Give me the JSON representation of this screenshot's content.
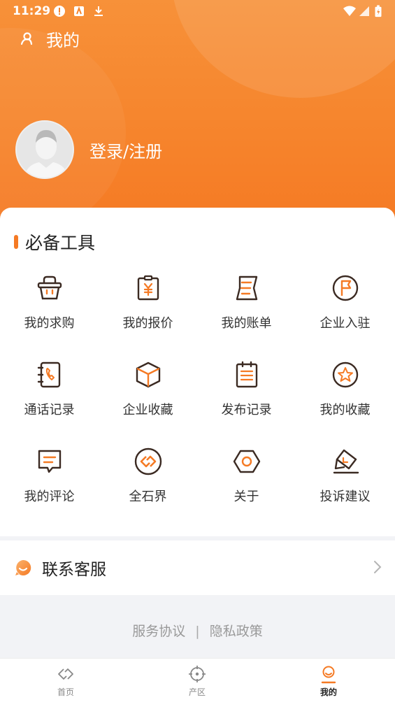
{
  "status_bar": {
    "time": "11:29"
  },
  "header": {
    "title": "我的"
  },
  "profile": {
    "login_label": "登录/注册"
  },
  "tools": {
    "section_title": "必备工具",
    "items": [
      {
        "label": "我的求购",
        "icon": "basket-icon"
      },
      {
        "label": "我的报价",
        "icon": "quote-icon"
      },
      {
        "label": "我的账单",
        "icon": "bill-icon"
      },
      {
        "label": "企业入驻",
        "icon": "flag-icon"
      },
      {
        "label": "通话记录",
        "icon": "phone-book-icon"
      },
      {
        "label": "企业收藏",
        "icon": "box-icon"
      },
      {
        "label": "发布记录",
        "icon": "clipboard-icon"
      },
      {
        "label": "我的收藏",
        "icon": "star-icon"
      },
      {
        "label": "我的评论",
        "icon": "comment-icon"
      },
      {
        "label": "全石界",
        "icon": "link-icon"
      },
      {
        "label": "关于",
        "icon": "hexagon-icon"
      },
      {
        "label": "投诉建议",
        "icon": "edit-icon"
      }
    ]
  },
  "service": {
    "label": "联系客服"
  },
  "footer": {
    "agreement": "服务协议",
    "separator": "|",
    "privacy": "隐私政策"
  },
  "tabbar": {
    "items": [
      {
        "label": "首页"
      },
      {
        "label": "产区"
      },
      {
        "label": "我的"
      }
    ],
    "active": "我的"
  },
  "colors": {
    "accent": "#f57a24",
    "icon_stroke": "#3b2a22"
  }
}
